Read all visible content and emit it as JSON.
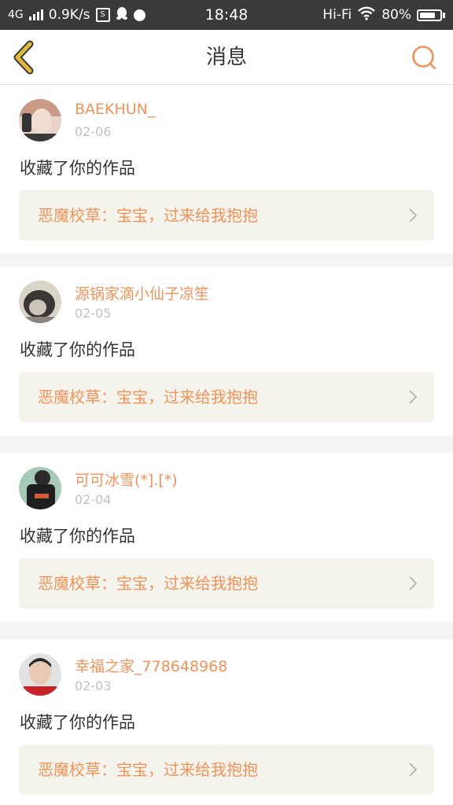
{
  "status_bar": {
    "network": "4G",
    "speed": "0.9K/s",
    "sim_icon": "S",
    "time": "18:48",
    "wifi_label": "Hi-Fi",
    "battery": "80%",
    "battery_level": 0.8
  },
  "header": {
    "title": "消息",
    "back_icon": "chevron-left-icon",
    "search_icon": "search-icon"
  },
  "colors": {
    "accent": "#f0935a",
    "back_arrow": "#e0b93a",
    "card_link_bg": "#f5f4ec"
  },
  "messages": [
    {
      "username": "BAEKHUN_",
      "date": "02-06",
      "action": "收藏了你的作品",
      "work_title": "恶魔校草：宝宝，过来给我抱抱"
    },
    {
      "username": "源锅家滴小仙子凉笙",
      "date": "02-05",
      "action": "收藏了你的作品",
      "work_title": "恶魔校草：宝宝，过来给我抱抱"
    },
    {
      "username": "可可冰雪(*].[*)",
      "date": "02-04",
      "action": "收藏了你的作品",
      "work_title": "恶魔校草：宝宝，过来给我抱抱"
    },
    {
      "username": "幸福之家_778648968",
      "date": "02-03",
      "action": "收藏了你的作品",
      "work_title": "恶魔校草：宝宝，过来给我抱抱"
    }
  ]
}
